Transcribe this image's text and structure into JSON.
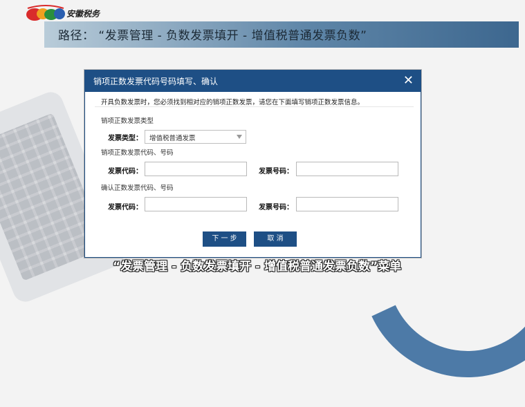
{
  "slide": {
    "logo_text": "安徽税务",
    "title": "路径：  “发票管理 - 负数发票填开 - 增值税普通发票负数”",
    "caption": "“发票管理 - 负数发票填开 - 增值税普通发票负数”菜单"
  },
  "dialog": {
    "title": "销项正数发票代码号码填写、确认",
    "close_glyph": "✕",
    "note": "开具负数发票时，您必须找到相对应的销项正数发票，请您在下面填写销项正数发票信息。",
    "section_type": "销项正数发票类型",
    "invoice_type_label": "发票类型：",
    "invoice_type_value": "增值税普通发票",
    "section_code": "销项正数发票代码、号码",
    "code_label": "发票代码：",
    "number_label": "发票号码：",
    "section_confirm": "确认正数发票代码、号码",
    "confirm_code_label": "发票代码：",
    "confirm_number_label": "发票号码：",
    "next_button": "下 一 步",
    "cancel_button": "取 消"
  },
  "colors": {
    "dialog_header": "#1e4f85",
    "button": "#1e4f85",
    "title_bar_gradient": [
      "#b9ccd9",
      "#3d678f"
    ]
  }
}
